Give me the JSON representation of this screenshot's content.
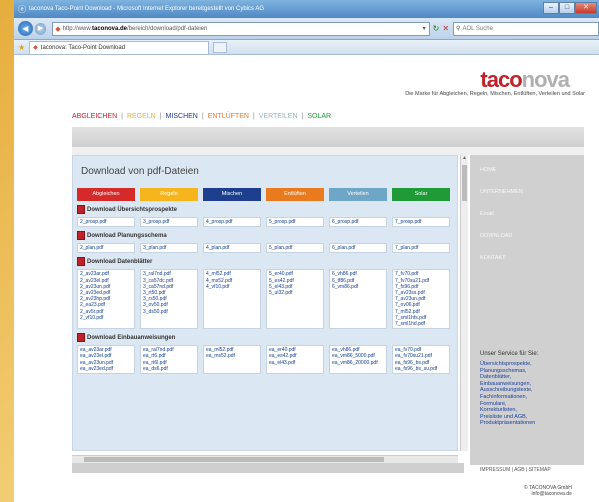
{
  "window": {
    "title": "taconova Taco-Point Download - Microsoft Internet Explorer bereitgestellt von Cybics AG"
  },
  "address_bar": {
    "prefix": "http://www.",
    "domain": "taconova.de",
    "path": "/bereich/download/pdf-dateien"
  },
  "search_box": {
    "placeholder": "AOL Suche"
  },
  "tab": {
    "label": "taconova: Taco-Point Download"
  },
  "brand": {
    "logo_main": "taco",
    "logo_accent": "nova",
    "tagline": "Die Marke für Abgleichen, Regeln, Mischen, Entlüften, Verteilen und Solar"
  },
  "main_nav": [
    {
      "label": "ABGLEICHEN",
      "color": "#c0222a"
    },
    {
      "label": "REGELN",
      "color": "#f3b11d"
    },
    {
      "label": "MISCHEN",
      "color": "#1d3f8d"
    },
    {
      "label": "ENTLÜFTEN",
      "color": "#ea7a1e"
    },
    {
      "label": "VERTEILEN",
      "color": "#8fb3cc"
    },
    {
      "label": "SOLAR",
      "color": "#1f9a36"
    }
  ],
  "page": {
    "heading": "Download von pdf-Dateien",
    "categories": [
      {
        "label": "Abgleichen",
        "color": "#d42a2a"
      },
      {
        "label": "Regeln",
        "color": "#f6b51c"
      },
      {
        "label": "Mischen",
        "color": "#1d3f8d"
      },
      {
        "label": "Entlüften",
        "color": "#ea7a1e"
      },
      {
        "label": "Verteilen",
        "color": "#6ea6c8"
      },
      {
        "label": "Solar",
        "color": "#1f9a36"
      }
    ],
    "sections": [
      {
        "title": "Download Übersichtsprospekte",
        "cells": [
          [
            "2_prosp.pdf"
          ],
          [
            "3_prosp.pdf"
          ],
          [
            "4_prosp.pdf"
          ],
          [
            "5_prosp.pdf"
          ],
          [
            "6_prosp.pdf"
          ],
          [
            "7_prosp.pdf"
          ]
        ]
      },
      {
        "title": "Download Planungsschema",
        "cells": [
          [
            "2_plan.pdf"
          ],
          [
            "3_plan.pdf"
          ],
          [
            "4_plan.pdf"
          ],
          [
            "5_plan.pdf"
          ],
          [
            "6_plan.pdf"
          ],
          [
            "7_plan.pdf"
          ]
        ]
      },
      {
        "title": "Download Datenblätter",
        "cells": [
          [
            "2_av23ar.pdf",
            "2_av23el.pdf",
            "2_av23un.pdf",
            "2_av23ed.pdf",
            "2_av23hp.pdf",
            "2_ea23.pdf",
            "2_av5r.pdf",
            "2_vf10.pdf"
          ],
          [
            "3_ral7nd.pdf",
            "3_ca57dc.pdf",
            "3_ca57nd.pdf",
            "3_rt50.pdf",
            "3_rs50.pdf",
            "3_ov50.pdf",
            "3_ds50.pdf"
          ],
          [
            "4_ml52.pdf",
            "4_ms52.pdf",
            "4_vf10.pdf"
          ],
          [
            "5_er40.pdf",
            "5_es42.pdf",
            "5_el43.pdf",
            "5_ul32.pdf"
          ],
          [
            "6_vh86.pdf",
            "6_tf86.pdf",
            "6_vm86.pdf"
          ],
          [
            "7_fv70.pdf",
            "7_fv70su21.pdf",
            "7_fs96.pdf",
            "7_av23ss.pdf",
            "7_av23un.pdf",
            "7_ov06.pdf",
            "7_ml52.pdf",
            "7_sml1hfs.pdf",
            "7_sml1hd.pdf"
          ]
        ]
      },
      {
        "title": "Download Einbauanweisungen",
        "cells": [
          [
            "ea_av23ar.pdf",
            "ea_av23el.pdf",
            "ea_av23un.pdf",
            "ea_av23ed.pdf"
          ],
          [
            "ea_ral7nd.pdf",
            "ea_rt6.pdf",
            "ea_rt6l.pdf",
            "ea_ds6.pdf"
          ],
          [
            "ea_ml52.pdf",
            "ea_ms52.pdf"
          ],
          [
            "ea_er40.pdf",
            "ea_es42.pdf",
            "ea_el43.pdf"
          ],
          [
            "ea_vh86.pdf",
            "ea_vm86_5000.pdf",
            "ea_vm86_20000.pdf"
          ],
          [
            "ea_fv70.pdf",
            "ea_fv70su21.pdf",
            "ea_fs96_bs.pdf",
            "ea_fs96_bs_su.pdf"
          ]
        ]
      }
    ]
  },
  "sidebar": {
    "nav": [
      "HOME",
      "UNTERNEHMEN",
      "Email",
      "DOWNLOAD",
      "KONTAKT"
    ],
    "service_title": "Unser Service für Sie:",
    "services": [
      "Übersichtsprospekte,",
      "Planungsschemas,",
      "Datenblätter,",
      "Einbauanweisungen,",
      "Ausschreibungstexte,",
      "Fachinformationen,",
      "Formulare,",
      "Korrekturlisten,",
      "Preisliste und AGB,",
      "Produktpräsentationen"
    ],
    "footer_links": "IMPRESSUM | AGB | SITEMAP",
    "copyright": [
      "© TACONOVA GmbH",
      "info@taconova.de"
    ]
  }
}
